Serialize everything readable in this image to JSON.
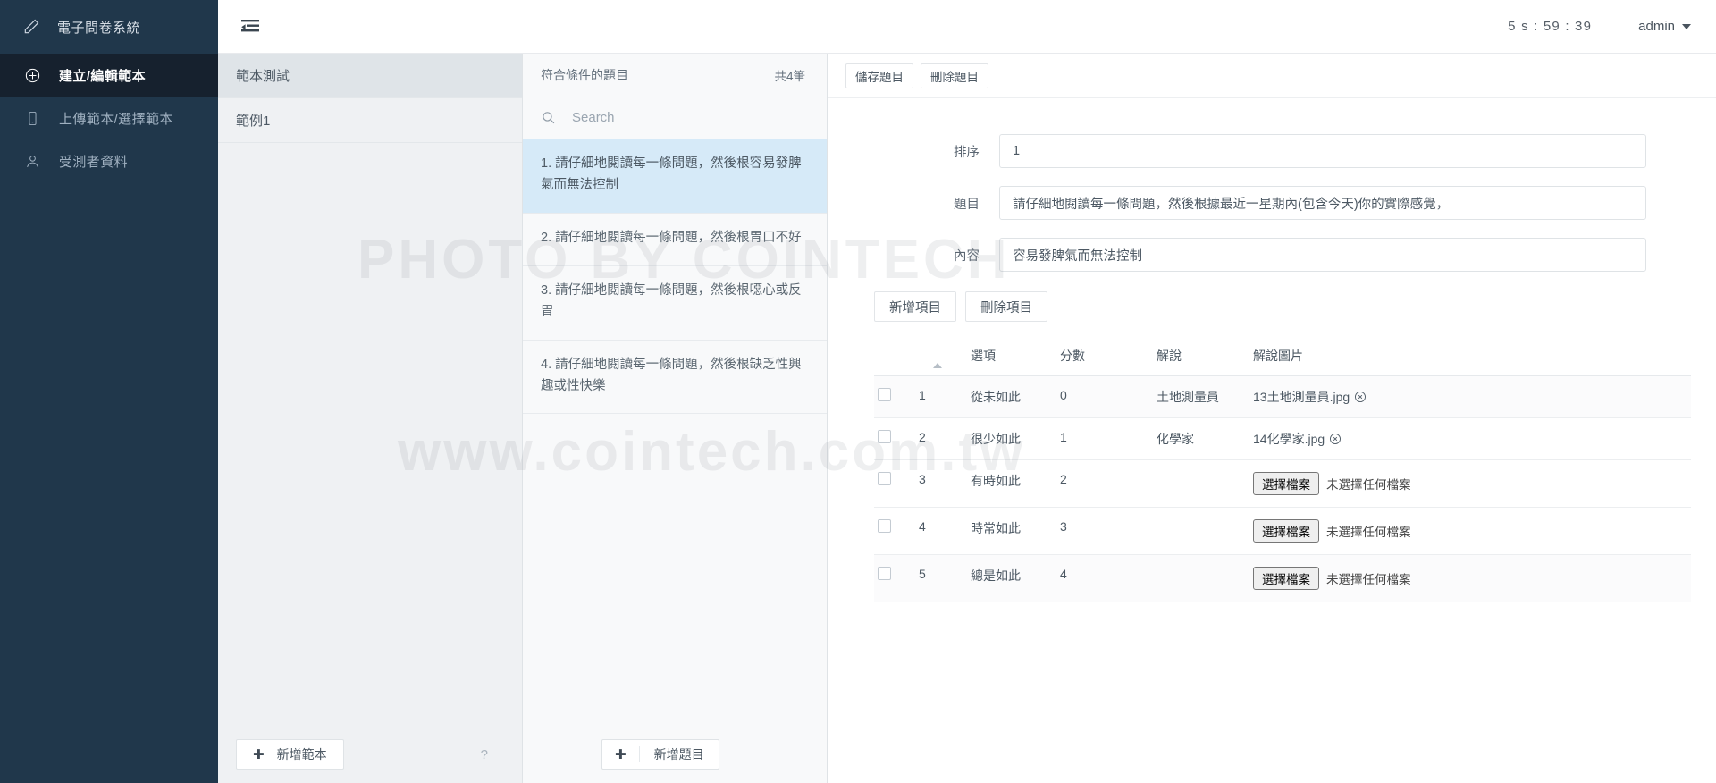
{
  "brand": {
    "title": "電子問卷系統",
    "icon": "pencil-icon"
  },
  "sidebar": {
    "items": [
      {
        "label": "建立/編輯範本",
        "icon": "plus-circle-icon",
        "active": true
      },
      {
        "label": "上傳範本/選擇範本",
        "icon": "mobile-icon",
        "active": false
      },
      {
        "label": "受測者資料",
        "icon": "user-icon",
        "active": false
      }
    ]
  },
  "topbar": {
    "menu_icon": "hamburger-indent-icon",
    "timer": "5 s : 59 : 39",
    "user": "admin"
  },
  "templates": {
    "items": [
      {
        "label": "範本測試",
        "selected": true
      },
      {
        "label": "範例1",
        "selected": false
      }
    ],
    "add_button": "新增範本",
    "add_plus": "✚",
    "help": "?"
  },
  "questions": {
    "header": "符合條件的題目",
    "count": "共4筆",
    "search_placeholder": "Search",
    "search_value": "",
    "items": [
      {
        "label": "1. 請仔細地閱讀每一條問題，然後根容易發脾氣而無法控制",
        "selected": true
      },
      {
        "label": "2. 請仔細地閱讀每一條問題，然後根胃口不好",
        "selected": false
      },
      {
        "label": "3. 請仔細地閱讀每一條問題，然後根噁心或反胃",
        "selected": false
      },
      {
        "label": "4. 請仔細地閱讀每一條問題，然後根缺乏性興趣或性快樂",
        "selected": false
      }
    ],
    "add_button": "新增題目",
    "add_plus": "✚"
  },
  "editor": {
    "toolbar": {
      "save_label": "儲存題目",
      "delete_label": "刪除題目"
    },
    "fields": {
      "order_label": "排序",
      "order_value": "1",
      "title_label": "題目",
      "title_value": "請仔細地閱讀每一條問題，然後根據最近一星期內(包含今天)你的實際感覺，",
      "content_label": "內容",
      "content_value": "容易發脾氣而無法控制"
    },
    "item_buttons": {
      "add_label": "新增項目",
      "delete_label": "刪除項目"
    },
    "table": {
      "columns": [
        "",
        "",
        "選項",
        "分數",
        "解說",
        "解說圖片"
      ],
      "sort_icon": "sort-asc-icon",
      "rows": [
        {
          "index": "1",
          "option": "從未如此",
          "score": "0",
          "explain": "土地測量員",
          "file_name": "13土地測量員.jpg",
          "has_file": true,
          "file_btn": "",
          "file_status": ""
        },
        {
          "index": "2",
          "option": "很少如此",
          "score": "1",
          "explain": "化學家",
          "file_name": "14化學家.jpg",
          "has_file": true,
          "file_btn": "",
          "file_status": ""
        },
        {
          "index": "3",
          "option": "有時如此",
          "score": "2",
          "explain": "",
          "file_name": "",
          "has_file": false,
          "file_btn": "選擇檔案",
          "file_status": "未選擇任何檔案"
        },
        {
          "index": "4",
          "option": "時常如此",
          "score": "3",
          "explain": "",
          "file_name": "",
          "has_file": false,
          "file_btn": "選擇檔案",
          "file_status": "未選擇任何檔案"
        },
        {
          "index": "5",
          "option": "總是如此",
          "score": "4",
          "explain": "",
          "file_name": "",
          "has_file": false,
          "file_btn": "選擇檔案",
          "file_status": "未選擇任何檔案"
        }
      ]
    }
  },
  "watermark": {
    "line1": "PHOTO BY COINTECH",
    "line2": "www.cointech.com.tw"
  },
  "colors": {
    "sidebar_bg": "#20374b",
    "sidebar_active_bg": "#16212e",
    "selection_blue": "#d6eaf8",
    "panel_bg": "#eff1f3"
  }
}
